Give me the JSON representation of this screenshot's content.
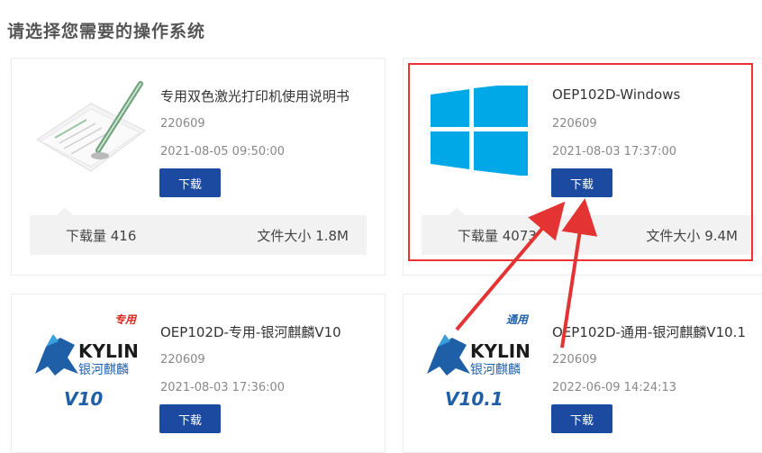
{
  "page_title": "请选择您需要的操作系统",
  "download_label": "下载",
  "cards": [
    {
      "name": "专用双色激光打印机使用说明书",
      "version": "220609",
      "date": "2021-08-05 09:50:00",
      "downloads": "下载量 416",
      "size": "文件大小 1.8M",
      "thumb": "manual-pen-icon"
    },
    {
      "name": "OEP102D-Windows",
      "version": "220609",
      "date": "2021-08-03 17:37:00",
      "downloads": "下载量 4073",
      "size": "文件大小 9.4M",
      "thumb": "windows-logo-icon"
    },
    {
      "name": "OEP102D-专用-银河麒麟V10",
      "version": "220609",
      "date": "2021-08-03 17:36:00",
      "thumb": "kylin-logo-icon",
      "logo": {
        "edition": "专用",
        "brand": "KYLIN",
        "cn": "银河麒麟",
        "version": "V10"
      }
    },
    {
      "name": "OEP102D-通用-银河麒麟V10.1",
      "version": "220609",
      "date": "2022-06-09 14:24:13",
      "thumb": "kylin-logo-icon",
      "logo": {
        "edition": "通用",
        "brand": "KYLIN",
        "cn": "银河麒麟",
        "version": "V10.1"
      }
    }
  ],
  "colors": {
    "button": "#1b4aa0",
    "windows": "#00a8e8",
    "kylin": "#1f5fa8",
    "highlight": "#e33333"
  }
}
